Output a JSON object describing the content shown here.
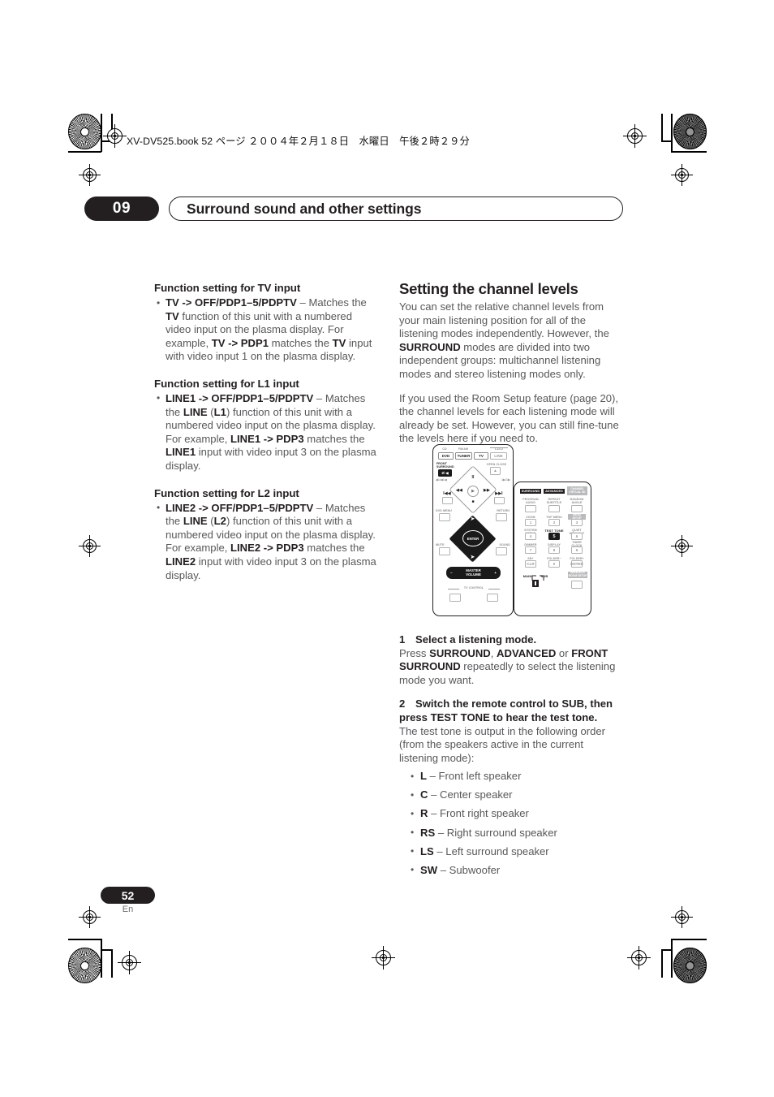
{
  "print_header": {
    "book_line": "XV-DV525.book  52 ページ  ２００４年２月１８日　水曜日　午後２時２９分"
  },
  "chapter": {
    "number": "09",
    "title": "Surround sound and other settings"
  },
  "left_column": {
    "sections": [
      {
        "heading": "Function setting for TV input",
        "bullets": [
          {
            "lead": "TV -> OFF/PDP1–5/PDPTV",
            "dash": " – ",
            "body_1": "Matches the ",
            "b1": "TV",
            "body_2": " function of this unit with a numbered video input on the plasma display. For example, ",
            "b2": "TV -> PDP1",
            "body_3": " matches the ",
            "b3": "TV",
            "body_4": " input with video input 1 on the plasma display."
          }
        ]
      },
      {
        "heading": "Function setting for L1 input",
        "bullets": [
          {
            "lead": "LINE1 -> OFF/PDP1–5/PDPTV",
            "dash": " – ",
            "body_1": "Matches the ",
            "b1": "LINE",
            "body_2": " (",
            "b2": "L1",
            "body_3": ") function of this unit with a numbered video input on the plasma display. For example, ",
            "b3": "LINE1 -> PDP3",
            "body_4": " matches the ",
            "b4": "LINE1",
            "body_5": " input with video input 3 on the plasma display."
          }
        ]
      },
      {
        "heading": "Function setting for L2 input",
        "bullets": [
          {
            "lead": "LINE2 -> OFF/PDP1–5/PDPTV",
            "dash": " – ",
            "body_1": "Matches the ",
            "b1": "LINE",
            "body_2": " (",
            "b2": "L2",
            "body_3": ") function of this unit with a numbered video input on the plasma display. For example, ",
            "b3": "LINE2 -> PDP3",
            "body_4": " matches the ",
            "b4": "LINE2",
            "body_5": " input with video input 3 on the plasma display."
          }
        ]
      }
    ]
  },
  "right_column": {
    "heading": "Setting the channel levels",
    "para1_a": "You can set the relative channel levels from your main listening position for all of the listening modes independently. However, the ",
    "para1_b": "SURROUND",
    "para1_c": " modes are divided into two independent groups: multichannel listening modes and stereo listening modes only.",
    "para2": "If you used the Room Setup feature (page 20), the channel levels for each listening mode will already be set. However, you can still fine-tune the levels here if you need to.",
    "steps": [
      {
        "number": "1",
        "title": "Select a listening mode.",
        "body_1": "Press ",
        "b1": "SURROUND",
        "body_2": ", ",
        "b2": "ADVANCED",
        "body_3": " or ",
        "b3": "FRONT SURROUND",
        "body_4": " repeatedly to select the listening mode you want."
      },
      {
        "number": "2",
        "title": "Switch the remote control to SUB, then press TEST TONE to hear the test tone.",
        "body": "The test tone is output in the following order (from the speakers active in the current listening mode):"
      }
    ],
    "speakers": [
      {
        "abbr": "L",
        "desc": " – Front left speaker"
      },
      {
        "abbr": "C",
        "desc": " – Center speaker"
      },
      {
        "abbr": "R",
        "desc": " – Front right speaker"
      },
      {
        "abbr": "RS",
        "desc": " – Right surround speaker"
      },
      {
        "abbr": "LS",
        "desc": " – Left surround speaker"
      },
      {
        "abbr": "SW",
        "desc": " – Subwoofer"
      }
    ]
  },
  "remote": {
    "main_unit": {
      "top_labels": [
        "CD",
        "FM/AM",
        "L1/L2"
      ],
      "source_buttons": [
        "DVD",
        "TUNER",
        "TV",
        "LINE"
      ],
      "front_surround_label": "FRONT\nSURROUND",
      "front_surround_button": "Ø ◀",
      "open_close_label": "OPEN CLOSE",
      "open_close_button": "▲",
      "pause_symbol": "II",
      "play_symbol": "▶",
      "stop_symbol": "■",
      "scan_rev": "◀◀",
      "scan_fwd": "▶▶",
      "skip_rev": "I◀◀",
      "skip_fwd": "▶▶I",
      "scan_label_left": "◀1/◀1◀",
      "scan_label_right": "1▶/1▶",
      "dvd_menu_label": "DVD MENU",
      "return_label": "RETURN",
      "mute_label": "MUTE",
      "sound_label": "SOUND",
      "enter_label": "ENTER",
      "master_volume_label": "MASTER\nVOLUME",
      "volume_minus": "−",
      "volume_plus": "+",
      "tv_control_label": "TV  CONTROL"
    },
    "sub_unit": {
      "mode_bars": [
        "SURROUND",
        "ADVANCED",
        "CHANNEL\nVIRTUAL 3D"
      ],
      "row_labels": [
        [
          "PROGRAM\nAUDIO",
          "REPEAT\nSUBTITLE",
          "RANDOM\nANGLE"
        ],
        [
          "ZOOM",
          "TOP MENU",
          "MENU\nSETUP"
        ],
        [
          "SYSTEM\nSETUP",
          "TEST TONE",
          "QUIET\nMIDNIGHT"
        ],
        [
          "DIMMER",
          "DISPLAY",
          "TIMER\nCLOCK"
        ],
        [
          "SR+",
          "FOLDER−",
          "FOLDER+"
        ]
      ],
      "numeric_buttons": [
        [
          "1",
          "2",
          "3"
        ],
        [
          "4",
          "5",
          "6"
        ],
        [
          "7",
          "8",
          "9"
        ],
        [
          "CLR",
          "0",
          "ENTER"
        ]
      ],
      "wireless_label": "WIRELESS\nROOM SETUP",
      "highlighted_button": "5",
      "switch_labels": {
        "main": "MAIN",
        "sub": "SUB"
      }
    }
  },
  "footer": {
    "page_number": "52",
    "language": "En"
  },
  "colors": {
    "ink": "#231f20",
    "body_text": "#58585a",
    "light_grey": "#98999b"
  }
}
